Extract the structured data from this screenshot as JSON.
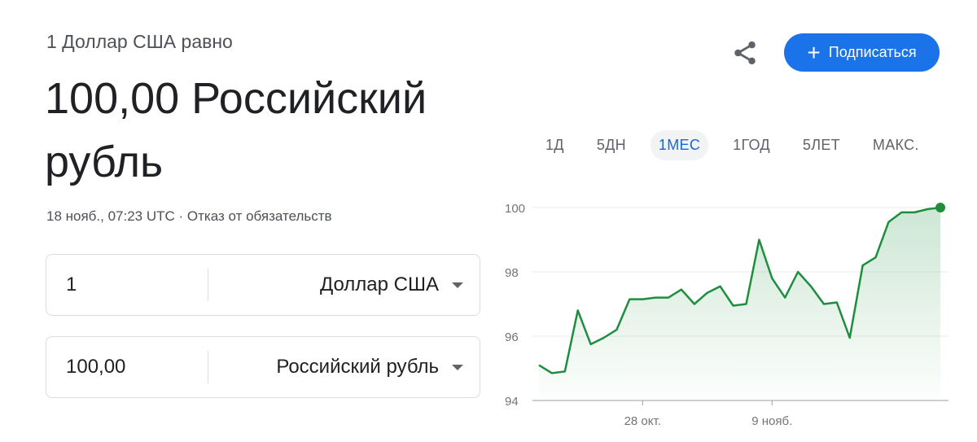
{
  "header": {
    "subtitle": "1 Доллар США равно",
    "value_line": "100,00 Российский рубль",
    "timestamp": "18 нояб., 07:23 UTC · Отказ от обязательств"
  },
  "actions": {
    "share_icon": "share-icon",
    "subscribe_icon": "plus-icon",
    "subscribe_label": "Подписаться",
    "accent_color": "#1a73e8"
  },
  "converter": {
    "from": {
      "amount": "1",
      "currency": "Доллар США"
    },
    "to": {
      "amount": "100,00",
      "currency": "Российский рубль"
    }
  },
  "tabs": [
    {
      "label": "1Д",
      "active": false
    },
    {
      "label": "5ДН",
      "active": false
    },
    {
      "label": "1МЕС",
      "active": true
    },
    {
      "label": "1ГОД",
      "active": false
    },
    {
      "label": "5ЛЕТ",
      "active": false
    },
    {
      "label": "МАКС.",
      "active": false
    }
  ],
  "chart_data": {
    "type": "area",
    "title": "",
    "xlabel": "",
    "ylabel": "",
    "ylim": [
      94,
      100
    ],
    "yticks": [
      94,
      96,
      98,
      100
    ],
    "xticks": [
      {
        "label": "28 окт.",
        "index": 8
      },
      {
        "label": "9 нояб.",
        "index": 18
      }
    ],
    "grid": true,
    "line_color": "#1e8e3e",
    "series": [
      {
        "values": [
          95.1,
          94.85,
          94.9,
          96.8,
          95.75,
          95.95,
          96.2,
          97.15,
          97.15,
          97.2,
          97.2,
          97.45,
          97.0,
          97.35,
          97.55,
          96.95,
          97.0,
          99.0,
          97.8,
          97.2,
          98.0,
          97.55,
          97.0,
          97.05,
          95.95,
          98.2,
          98.45,
          99.55,
          99.85,
          99.85,
          99.95,
          100.0
        ]
      }
    ]
  }
}
